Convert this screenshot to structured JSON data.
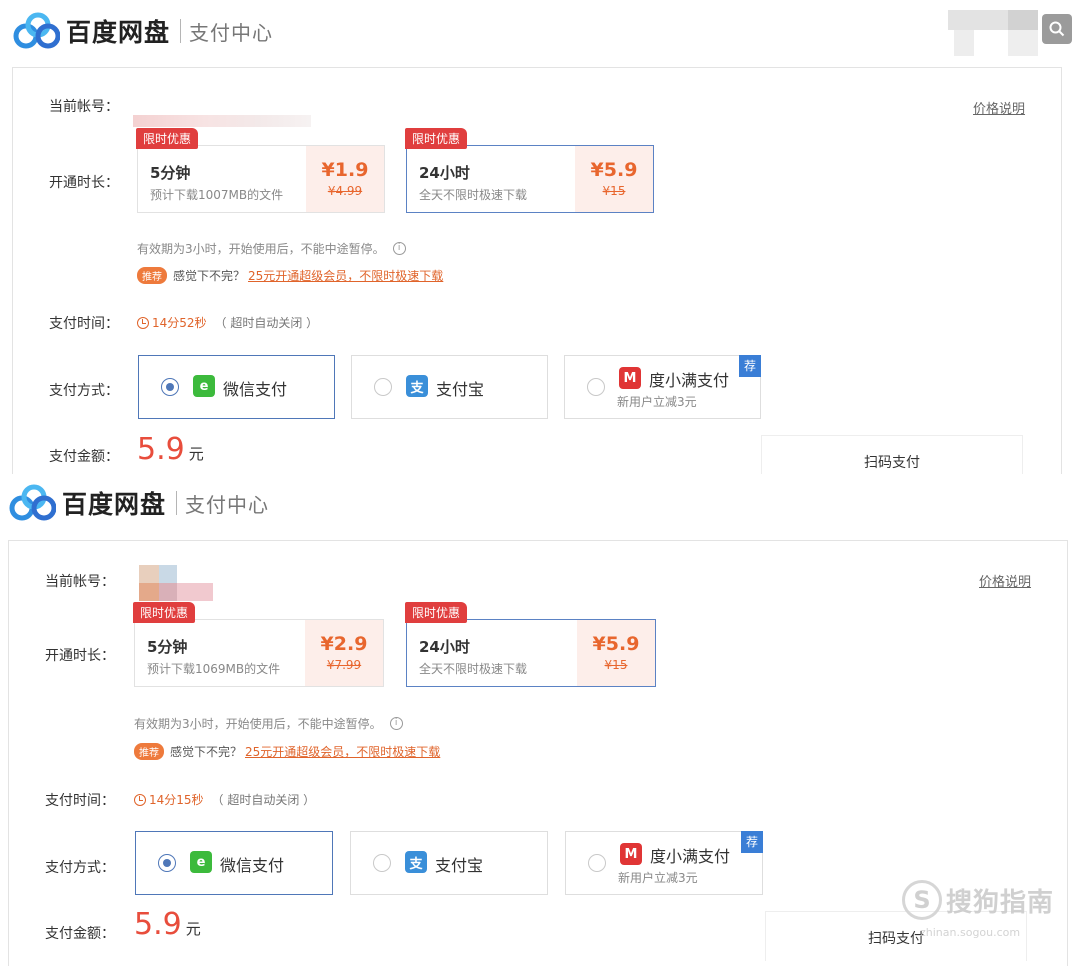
{
  "brand": {
    "name": "百度网盘",
    "subtitle": "支付中心"
  },
  "labels": {
    "account": "当前帐号：",
    "duration": "开通时长：",
    "pay_time": "支付时间：",
    "pay_method": "支付方式：",
    "pay_amount": "支付金额："
  },
  "price_note_link": "价格说明",
  "validity_note": "有效期为3小时，开始使用后，不能中途暂停。",
  "promo": {
    "badge": "推荐",
    "text": "感觉下不完？",
    "link": "25元开通超级会员，不限时极速下载"
  },
  "timer_suffix": "（ 超时自动关闭 ）",
  "payment_methods": {
    "wechat": "微信支付",
    "alipay": "支付宝",
    "duxiaoman": "度小满支付",
    "duxiaoman_sub": "新用户立减3元",
    "rec_badge": "荐"
  },
  "amount_unit": "元",
  "scan_label": "扫码支付",
  "panels": [
    {
      "options": [
        {
          "tag": "限时优惠",
          "name": "5分钟",
          "desc": "预计下载1007MB的文件",
          "price": "¥1.9",
          "original": "¥4.99",
          "selected": false
        },
        {
          "tag": "限时优惠",
          "name": "24小时",
          "desc": "全天不限时极速下载",
          "price": "¥5.9",
          "original": "¥15",
          "selected": true
        }
      ],
      "timer": "14分52秒",
      "amount": "5.9",
      "selected_payment": "wechat"
    },
    {
      "options": [
        {
          "tag": "限时优惠",
          "name": "5分钟",
          "desc": "预计下载1069MB的文件",
          "price": "¥2.9",
          "original": "¥7.99",
          "selected": false
        },
        {
          "tag": "限时优惠",
          "name": "24小时",
          "desc": "全天不限时极速下载",
          "price": "¥5.9",
          "original": "¥15",
          "selected": true
        }
      ],
      "timer": "14分15秒",
      "amount": "5.9",
      "selected_payment": "wechat"
    }
  ],
  "watermark": {
    "text": "搜狗指南",
    "url": "zhinan.sogou.com"
  },
  "colors": {
    "accent": "#4f77b8",
    "price": "#e8662e",
    "amount": "#e84d3c",
    "tag": "#e03e3e"
  },
  "icons": {
    "logo": "baidu-netdisk-cloud-icon",
    "info": "info-icon",
    "clock": "clock-icon",
    "wechat": "wechat-pay-icon",
    "alipay": "alipay-icon",
    "duxiaoman": "duxiaoman-icon",
    "search": "search-icon"
  }
}
